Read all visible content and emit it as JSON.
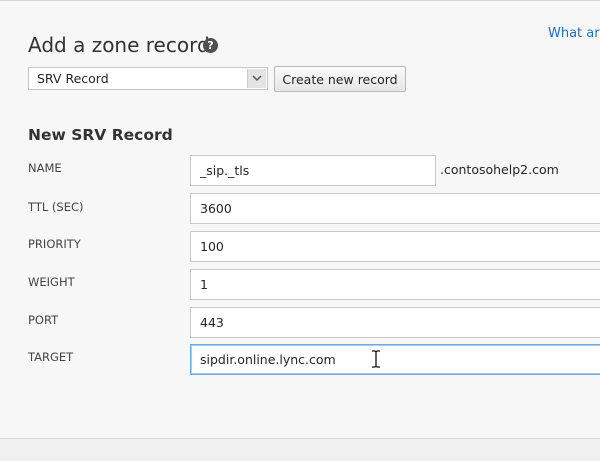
{
  "header": {
    "help_link": "What are",
    "title": "Add a zone record",
    "help_icon": "question-circle-icon"
  },
  "record_type": {
    "selected": "SRV Record",
    "create_button": "Create new record"
  },
  "form": {
    "title": "New SRV Record",
    "domain_suffix": ".contosohelp2.com",
    "fields": [
      {
        "label": "NAME",
        "value": "_sip._tls"
      },
      {
        "label": "TTL (SEC)",
        "value": "3600"
      },
      {
        "label": "PRIORITY",
        "value": "100"
      },
      {
        "label": "WEIGHT",
        "value": "1"
      },
      {
        "label": "PORT",
        "value": "443"
      },
      {
        "label": "TARGET",
        "value": "sipdir.online.lync.com"
      }
    ]
  },
  "cursor": "i-beam-cursor-icon"
}
